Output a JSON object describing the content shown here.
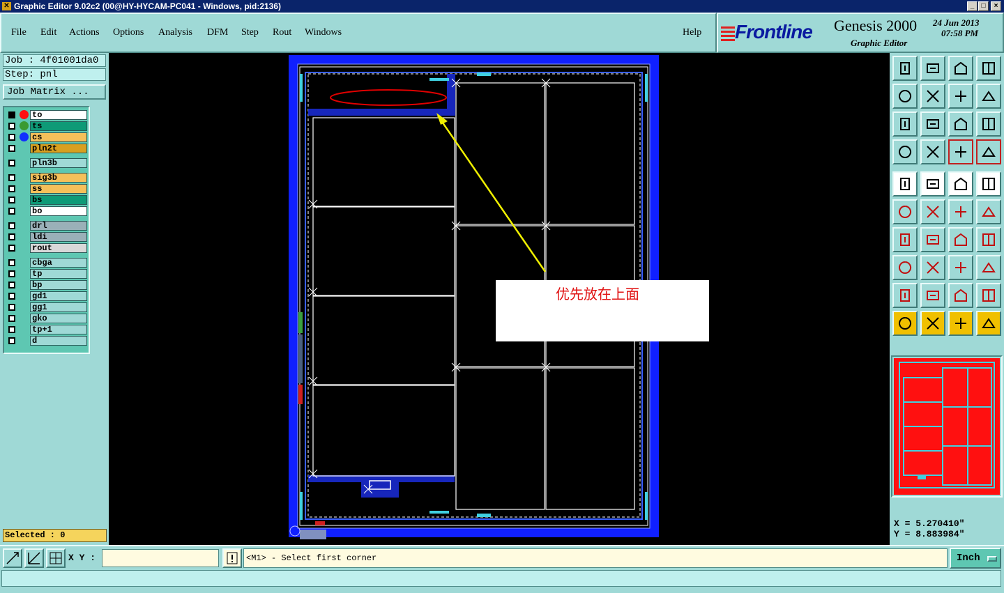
{
  "window": {
    "title": "Graphic Editor 9.02c2 (00@HY-HYCAM-PC041 - Windows, pid:2136)"
  },
  "menu": [
    {
      "label": "File"
    },
    {
      "label": "Edit"
    },
    {
      "label": "Actions"
    },
    {
      "label": "Options"
    },
    {
      "label": "Analysis"
    },
    {
      "label": "DFM"
    },
    {
      "label": "Step"
    },
    {
      "label": "Rout"
    },
    {
      "label": "Windows"
    },
    {
      "label": "Help"
    }
  ],
  "brand": {
    "logo": "Frontline",
    "product": "Genesis 2000",
    "subtitle": "Graphic Editor",
    "date": "24 Jun 2013",
    "time": "07:58 PM"
  },
  "job": {
    "job_label": "Job : 4f01001da0",
    "step_label": "Step: pnl",
    "matrix_button": "Job Matrix ..."
  },
  "layers": [
    {
      "name": "to",
      "color": "#ffffff",
      "dot": "#ff1010"
    },
    {
      "name": "ts",
      "color": "#0e9a77",
      "dot": "#3a9a30"
    },
    {
      "name": "cs",
      "color": "#f5c05a",
      "dot": "#1030ff"
    },
    {
      "name": "pln2t",
      "color": "#d8a020",
      "dot": ""
    },
    {
      "name": "pln3b",
      "color": "#9fd9d6",
      "dot": ""
    },
    {
      "name": "sig3b",
      "color": "#f5c05a",
      "dot": ""
    },
    {
      "name": "ss",
      "color": "#f5c05a",
      "dot": ""
    },
    {
      "name": "bs",
      "color": "#0e9a77",
      "dot": ""
    },
    {
      "name": "bo",
      "color": "#ffffff",
      "dot": ""
    },
    {
      "name": "drl",
      "color": "#9ab0b8",
      "dot": ""
    },
    {
      "name": "ldi",
      "color": "#9ab0b8",
      "dot": ""
    },
    {
      "name": "rout",
      "color": "#d8d8d8",
      "dot": ""
    },
    {
      "name": "cbga",
      "color": "#9fd9d6",
      "dot": ""
    },
    {
      "name": "tp",
      "color": "#9fd9d6",
      "dot": ""
    },
    {
      "name": "bp",
      "color": "#9fd9d6",
      "dot": ""
    },
    {
      "name": "gd1",
      "color": "#9fd9d6",
      "dot": ""
    },
    {
      "name": "gg1",
      "color": "#9fd9d6",
      "dot": ""
    },
    {
      "name": "gko",
      "color": "#9fd9d6",
      "dot": ""
    },
    {
      "name": "tp+1",
      "color": "#9fd9d6",
      "dot": ""
    },
    {
      "name": "d",
      "color": "#9fd9d6",
      "dot": ""
    }
  ],
  "selected": "Selected : 0",
  "annotation": {
    "text": "优先放在上面"
  },
  "coords": {
    "x": "X = 5.270410\"",
    "y": "Y = 8.883984\""
  },
  "command": {
    "xy_label": "X Y :",
    "xy_value": "",
    "prompt": "<M1> - Select first corner",
    "units": "Inch"
  }
}
